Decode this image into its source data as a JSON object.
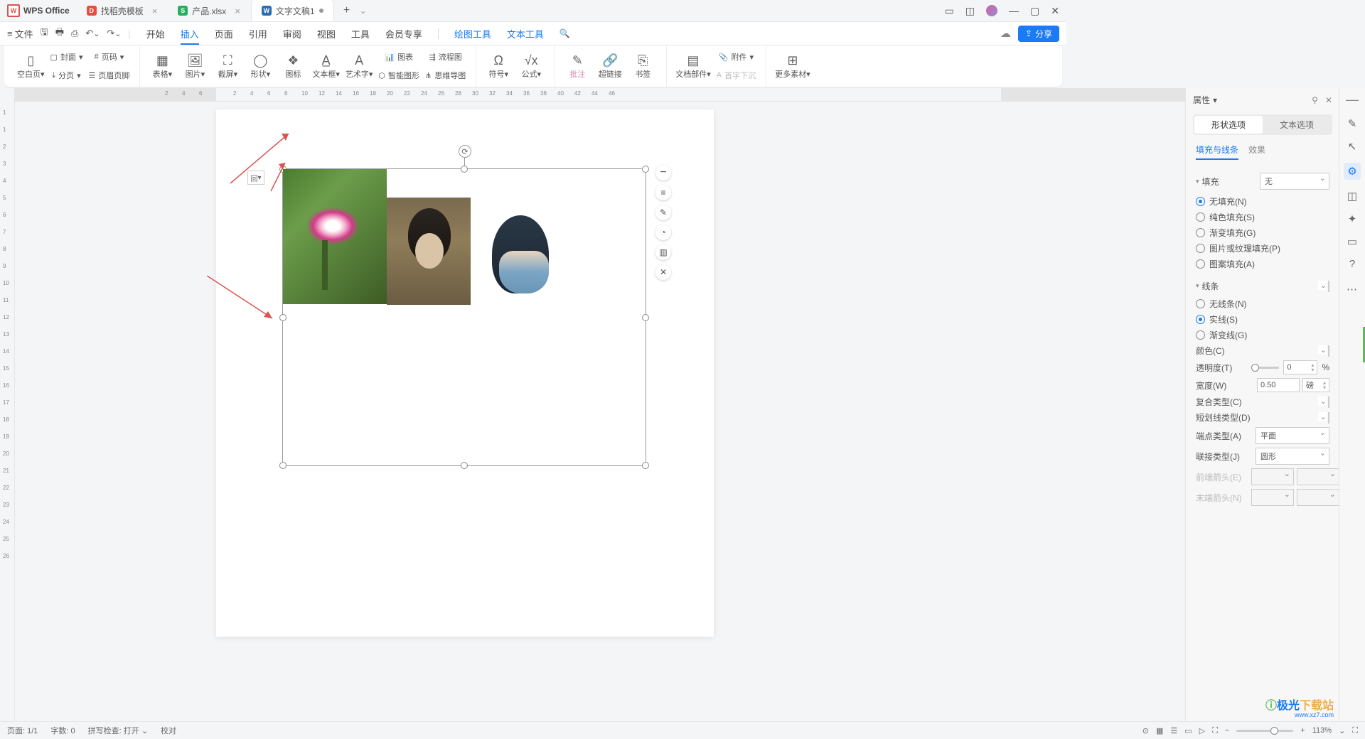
{
  "app_name": "WPS Office",
  "tabs": [
    {
      "icon_bg": "#e84c3d",
      "icon_txt": "D",
      "label": "找稻壳模板",
      "active": false
    },
    {
      "icon_bg": "#27ae60",
      "icon_txt": "S",
      "label": "产品.xlsx",
      "active": false
    },
    {
      "icon_bg": "#2b6cb0",
      "icon_txt": "W",
      "label": "文字文稿1",
      "active": true
    }
  ],
  "file_label": "文件",
  "menu": [
    "开始",
    "插入",
    "页面",
    "引用",
    "审阅",
    "视图",
    "工具",
    "会员专享"
  ],
  "menu_extra": [
    "绘图工具",
    "文本工具"
  ],
  "share_label": "分享",
  "ribbon": {
    "blank_page": "空白页",
    "cover": "封面",
    "page_num": "页码",
    "page_break": "分页",
    "header_footer": "页眉页脚",
    "table": "表格",
    "picture": "图片",
    "screenshot": "截屏",
    "shape": "形状",
    "icon": "图标",
    "textbox": "文本框",
    "wordart": "艺术字",
    "chart": "图表",
    "smart_shape": "智能图形",
    "flowchart": "流程图",
    "mindmap": "思维导图",
    "symbol": "符号",
    "formula": "公式",
    "comment": "批注",
    "hyperlink": "超链接",
    "bookmark": "书签",
    "doc_part": "文档部件",
    "dropcap": "首字下沉",
    "attachment": "附件",
    "more": "更多素材"
  },
  "ruler_h": [
    "2",
    "4",
    "6",
    "8",
    "10",
    "12",
    "14",
    "16",
    "18",
    "20",
    "22",
    "24",
    "26",
    "28",
    "30",
    "32",
    "34",
    "36",
    "38",
    "40",
    "42",
    "44",
    "46"
  ],
  "ruler_h_neg": [
    "2",
    "4",
    "6"
  ],
  "ruler_v": [
    "1",
    "1",
    "2",
    "3",
    "4",
    "5",
    "6",
    "7",
    "8",
    "9",
    "10",
    "11",
    "12",
    "13",
    "14",
    "15",
    "16",
    "17",
    "18",
    "19",
    "20",
    "21",
    "22",
    "23",
    "24",
    "25",
    "26"
  ],
  "floating": [
    "−",
    "≡",
    "✎",
    "◔",
    "▥",
    "✕"
  ],
  "layout_badge": "回",
  "panel": {
    "title": "属性",
    "seg": [
      "形状选项",
      "文本选项"
    ],
    "subtabs": [
      "填充与线条",
      "效果"
    ],
    "fill_label": "填充",
    "fill_sel": "无",
    "fill_opts": [
      "无填充(N)",
      "纯色填充(S)",
      "渐变填充(G)",
      "图片或纹理填充(P)",
      "图案填充(A)"
    ],
    "fill_checked": 0,
    "line_label": "线条",
    "line_opts": [
      "无线条(N)",
      "实线(S)",
      "渐变线(G)"
    ],
    "line_checked": 1,
    "color_lab": "颜色(C)",
    "trans_lab": "透明度(T)",
    "trans_val": "0",
    "trans_unit": "%",
    "width_lab": "宽度(W)",
    "width_val": "0.50",
    "width_unit": "磅",
    "compound_lab": "复合类型(C)",
    "dash_lab": "短划线类型(D)",
    "cap_lab": "端点类型(A)",
    "cap_val": "平面",
    "join_lab": "联接类型(J)",
    "join_val": "圆形",
    "arrow1": "前端箭头(E)",
    "arrow2": "末端箭头(N)"
  },
  "status": {
    "page": "页面: 1/1",
    "words": "字数: 0",
    "spell": "拼写检查: 打开",
    "proof": "校对",
    "zoom": "113%"
  },
  "watermark": {
    "t1a": "极光",
    "t1b": "下载站",
    "t2": "www.xz7.com"
  }
}
